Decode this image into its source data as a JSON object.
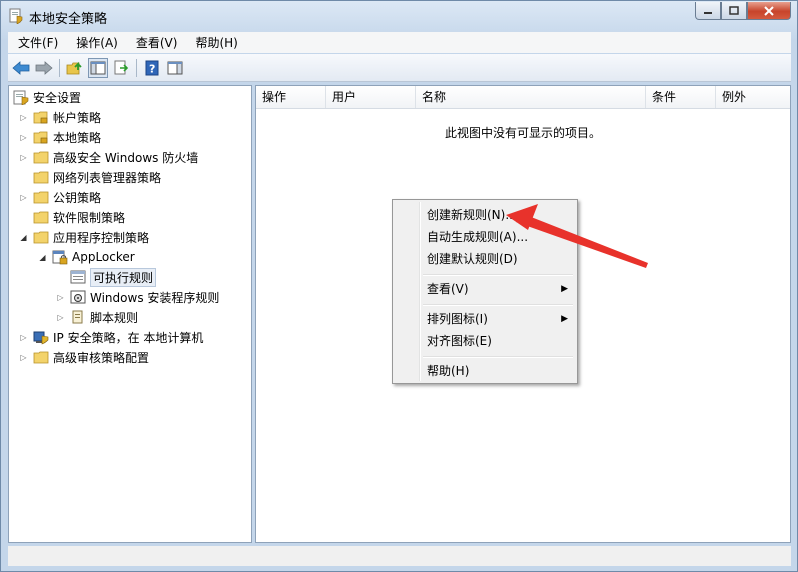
{
  "window": {
    "title": "本地安全策略"
  },
  "menubar": {
    "items": [
      "文件(F)",
      "操作(A)",
      "查看(V)",
      "帮助(H)"
    ]
  },
  "toolbar": {
    "icons": [
      "back-arrow-icon",
      "forward-arrow-icon",
      "up-folder-icon",
      "show-hide-tree-icon",
      "export-list-icon",
      "help-icon",
      "properties-pane-icon"
    ]
  },
  "tree": {
    "root": "安全设置",
    "items": [
      {
        "label": "帐户策略"
      },
      {
        "label": "本地策略"
      },
      {
        "label": "高级安全 Windows 防火墙"
      },
      {
        "label": "网络列表管理器策略"
      },
      {
        "label": "公钥策略"
      },
      {
        "label": "软件限制策略"
      },
      {
        "label": "应用程序控制策略"
      },
      {
        "label": "AppLocker"
      },
      {
        "label": "可执行规则"
      },
      {
        "label": "Windows 安装程序规则"
      },
      {
        "label": "脚本规则"
      },
      {
        "label": "IP 安全策略，在 本地计算机"
      },
      {
        "label": "高级审核策略配置"
      }
    ]
  },
  "list": {
    "columns": [
      "操作",
      "用户",
      "名称",
      "条件",
      "例外"
    ],
    "empty_message": "此视图中没有可显示的项目。"
  },
  "context_menu": {
    "items": [
      {
        "label": "创建新规则(N)..."
      },
      {
        "label": "自动生成规则(A)..."
      },
      {
        "label": "创建默认规则(D)"
      },
      {
        "label": "查看(V)"
      },
      {
        "label": "排列图标(I)"
      },
      {
        "label": "对齐图标(E)"
      },
      {
        "label": "帮助(H)"
      }
    ]
  },
  "colors": {
    "annotation_arrow": "#e8322b"
  }
}
